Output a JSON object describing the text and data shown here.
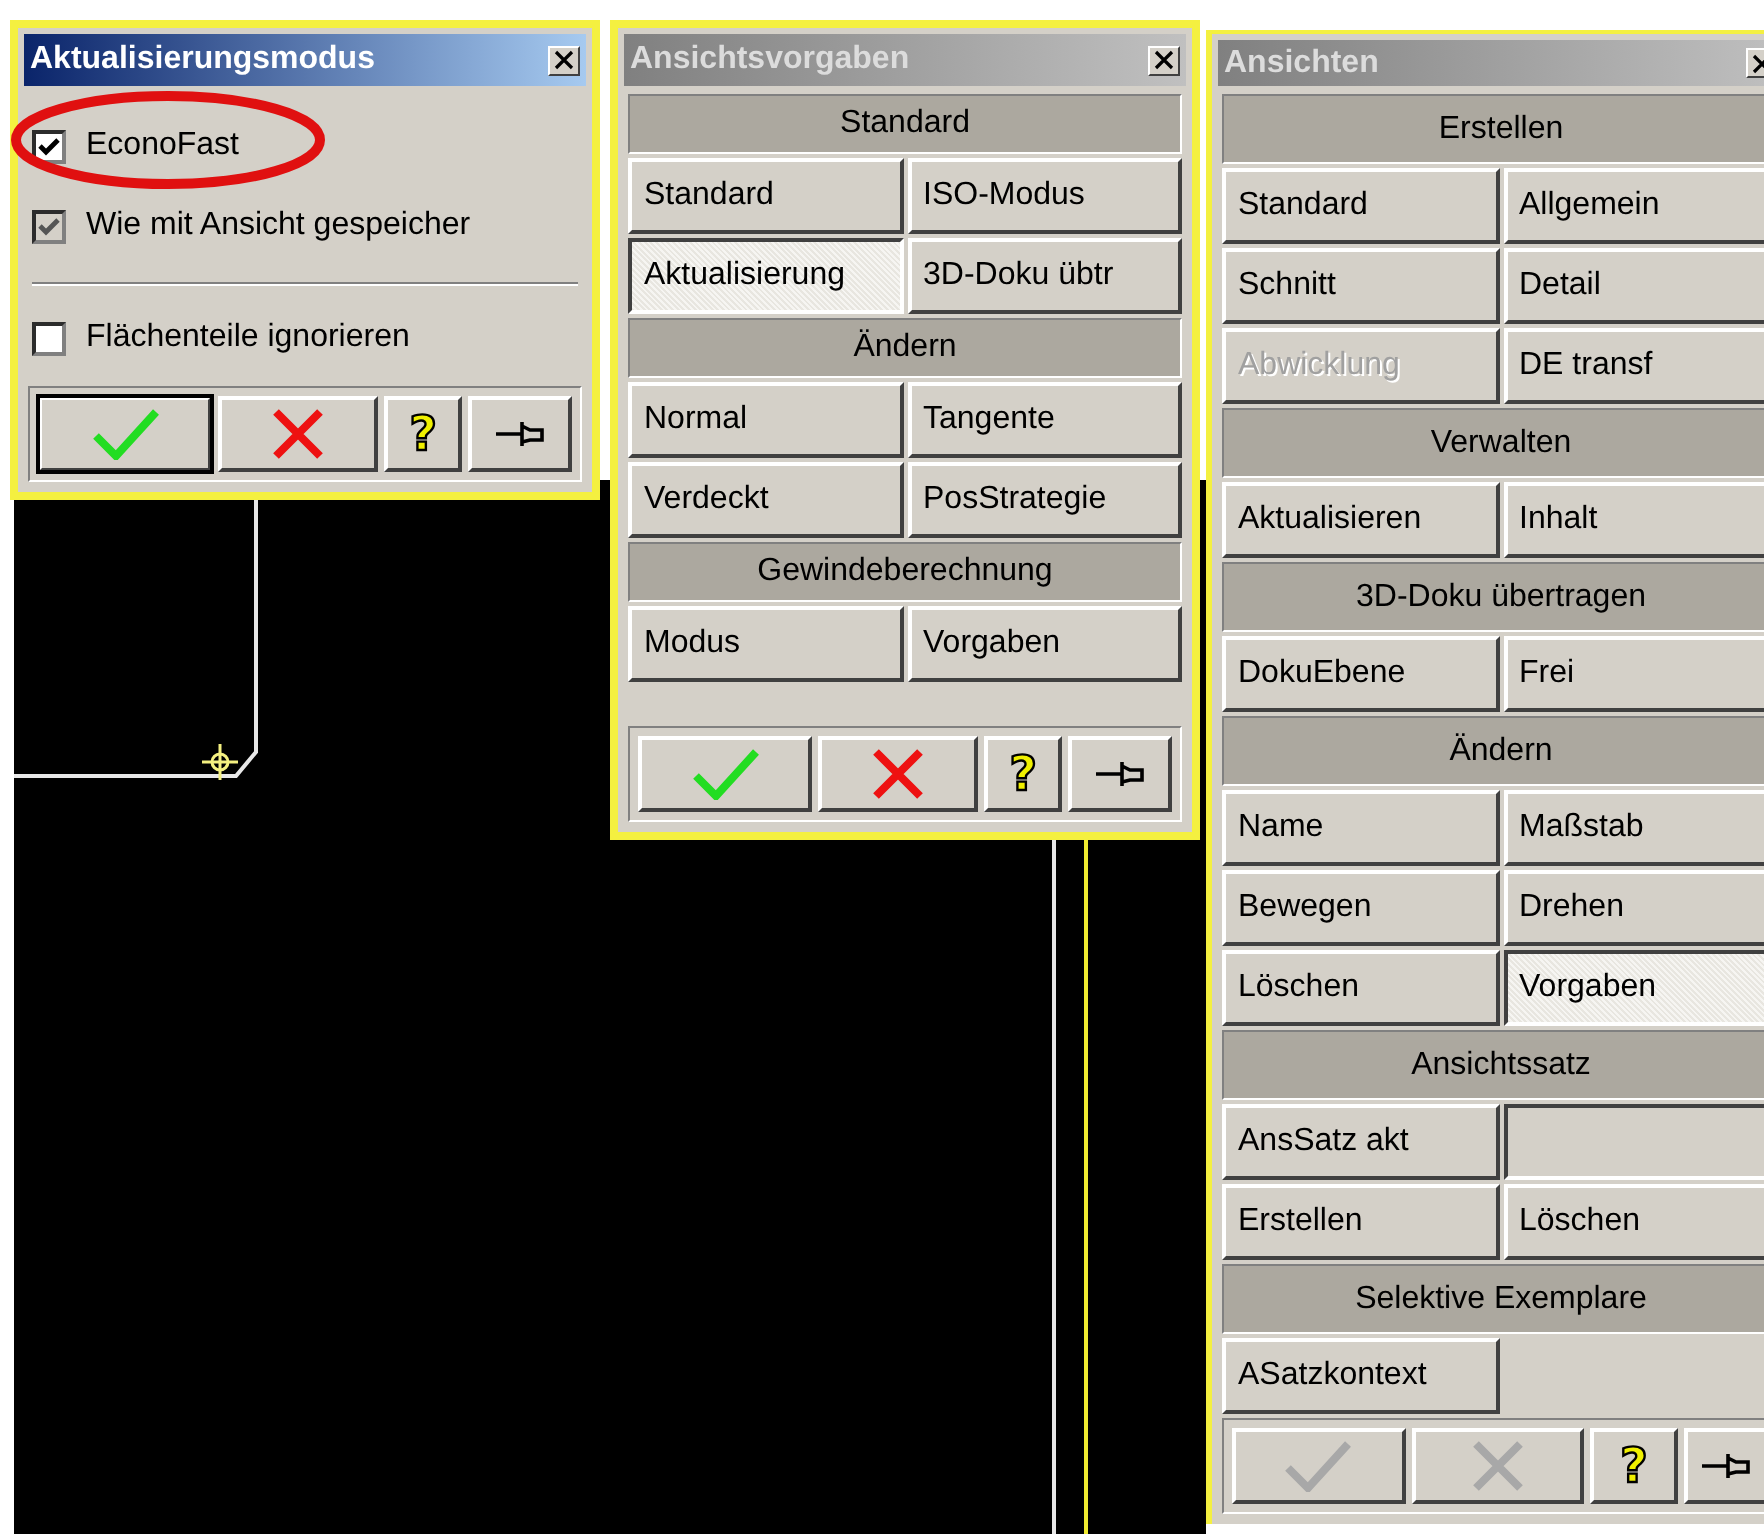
{
  "panels": [
    {
      "kind": "options",
      "title": "Aktualisierungsmodus",
      "active": true,
      "groups": [
        [
          {
            "label": "EconoFast",
            "checked": true,
            "disabled": false
          },
          {
            "label": "Wie mit Ansicht gespeicher",
            "checked": true,
            "disabled": true
          }
        ],
        [
          {
            "label": "Flächenteile ignorieren",
            "checked": false,
            "disabled": false
          }
        ]
      ],
      "footer": {
        "help": "?",
        "disabled": false,
        "default_ok": true
      }
    },
    {
      "kind": "buttons",
      "title": "Ansichtsvorgaben",
      "active": false,
      "sections": [
        {
          "heading": "Standard",
          "buttons": [
            {
              "kind": "button",
              "label": "Standard",
              "pressed": false,
              "disabled": false
            },
            {
              "kind": "button",
              "label": "ISO-Modus",
              "pressed": false,
              "disabled": false
            },
            {
              "kind": "button",
              "label": "Aktualisierung",
              "pressed": true,
              "disabled": false
            },
            {
              "kind": "button",
              "label": "3D-Doku übtr",
              "pressed": false,
              "disabled": false
            }
          ]
        },
        {
          "heading": "Ändern",
          "buttons": [
            {
              "kind": "button",
              "label": "Normal",
              "pressed": false,
              "disabled": false
            },
            {
              "kind": "button",
              "label": "Tangente",
              "pressed": false,
              "disabled": false
            },
            {
              "kind": "button",
              "label": "Verdeckt",
              "pressed": false,
              "disabled": false
            },
            {
              "kind": "button",
              "label": "PosStrategie",
              "pressed": false,
              "disabled": false
            }
          ]
        },
        {
          "heading": "Gewindeberechnung",
          "buttons": [
            {
              "kind": "button",
              "label": "Modus",
              "pressed": false,
              "disabled": false
            },
            {
              "kind": "button",
              "label": "Vorgaben",
              "pressed": false,
              "disabled": false
            }
          ]
        }
      ],
      "footer": {
        "help": "?",
        "disabled": false,
        "default_ok": false
      }
    },
    {
      "kind": "buttons",
      "title": "Ansichten",
      "active": false,
      "sections": [
        {
          "heading": "Erstellen",
          "buttons": [
            {
              "kind": "button",
              "label": "Standard",
              "pressed": false,
              "disabled": false
            },
            {
              "kind": "button",
              "label": "Allgemein",
              "pressed": false,
              "disabled": false
            },
            {
              "kind": "button",
              "label": "Schnitt",
              "pressed": false,
              "disabled": false
            },
            {
              "kind": "button",
              "label": "Detail",
              "pressed": false,
              "disabled": false
            },
            {
              "kind": "button",
              "label": "Abwicklung",
              "pressed": false,
              "disabled": true
            },
            {
              "kind": "button",
              "label": "DE transf",
              "pressed": false,
              "disabled": false
            }
          ]
        },
        {
          "heading": "Verwalten",
          "buttons": [
            {
              "kind": "button",
              "label": "Aktualisieren",
              "pressed": false,
              "disabled": false
            },
            {
              "kind": "button",
              "label": "Inhalt",
              "pressed": false,
              "disabled": false
            }
          ]
        },
        {
          "heading": "3D-Doku übertragen",
          "buttons": [
            {
              "kind": "button",
              "label": "DokuEbene",
              "pressed": false,
              "disabled": false
            },
            {
              "kind": "button",
              "label": "Frei",
              "pressed": false,
              "disabled": false
            }
          ]
        },
        {
          "heading": "Ändern",
          "buttons": [
            {
              "kind": "button",
              "label": "Name",
              "pressed": false,
              "disabled": false
            },
            {
              "kind": "button",
              "label": "Maßstab",
              "pressed": false,
              "disabled": false
            },
            {
              "kind": "button",
              "label": "Bewegen",
              "pressed": false,
              "disabled": false
            },
            {
              "kind": "button",
              "label": "Drehen",
              "pressed": false,
              "disabled": false
            },
            {
              "kind": "button",
              "label": "Löschen",
              "pressed": false,
              "disabled": false
            },
            {
              "kind": "button",
              "label": "Vorgaben",
              "pressed": true,
              "disabled": false
            }
          ]
        },
        {
          "heading": "Ansichtssatz",
          "buttons": [
            {
              "kind": "button",
              "label": "AnsSatz akt",
              "pressed": false,
              "disabled": false
            },
            {
              "kind": "field"
            },
            {
              "kind": "button",
              "label": "Erstellen",
              "pressed": false,
              "disabled": false
            },
            {
              "kind": "button",
              "label": "Löschen",
              "pressed": false,
              "disabled": false
            }
          ]
        },
        {
          "heading": "Selektive Exemplare",
          "buttons": [
            {
              "kind": "button",
              "label": "ASatzkontext",
              "pressed": false,
              "disabled": false
            }
          ]
        }
      ],
      "footer": {
        "help": "?",
        "disabled": true,
        "default_ok": false
      }
    }
  ]
}
